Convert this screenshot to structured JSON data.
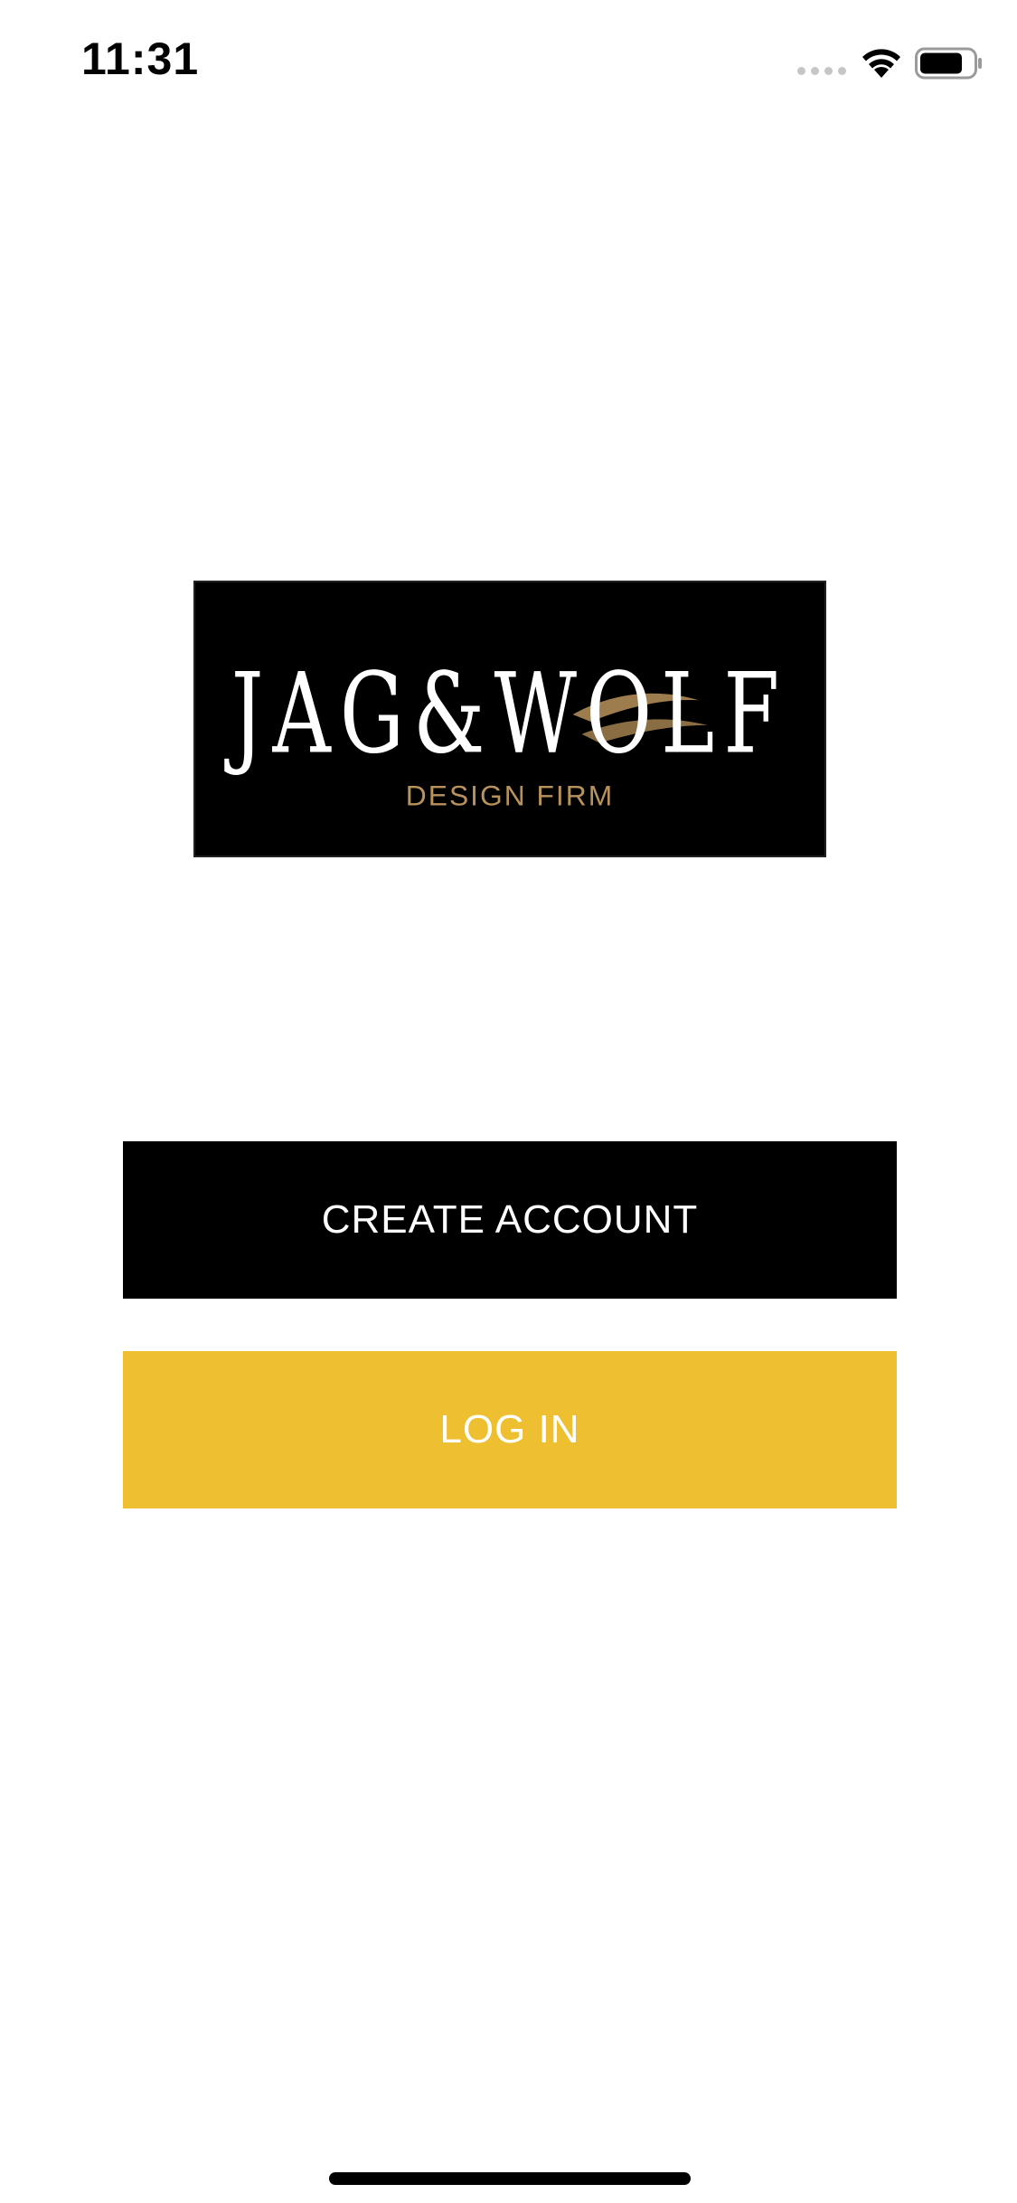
{
  "status_bar": {
    "time": "11:31",
    "signal_icon": "cellular-signal-icon",
    "wifi_icon": "wifi-icon",
    "battery_icon": "battery-icon",
    "battery_level": 0.75
  },
  "logo": {
    "brand_name": "JAG & WOLF",
    "tagline": "DESIGN FIRM",
    "colors": {
      "background": "#000000",
      "wordmark": "#ffffff",
      "accent": "#b8925a"
    }
  },
  "actions": {
    "create_account_label": "CREATE ACCOUNT",
    "login_label": "LOG IN"
  },
  "colors": {
    "create_account_bg": "#000000",
    "login_bg": "#eebf30",
    "button_text": "#ffffff"
  }
}
